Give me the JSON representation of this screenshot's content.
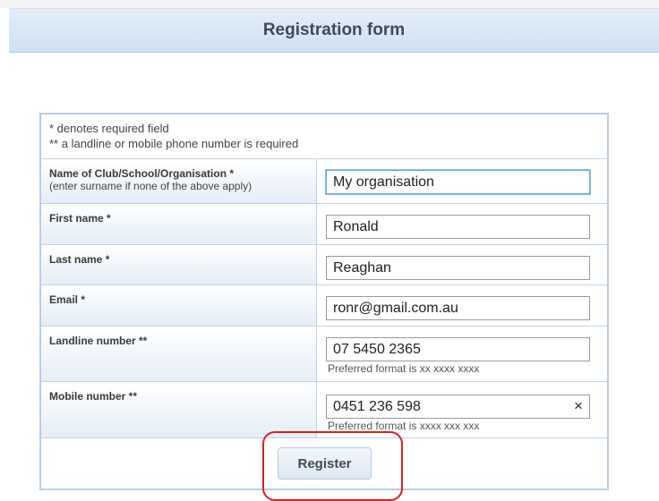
{
  "header": {
    "title": "Registration form"
  },
  "notes": {
    "required": "* denotes required field",
    "phone": "** a landline or mobile phone number is required"
  },
  "fields": {
    "organisation": {
      "label": "Name of Club/School/Organisation *",
      "sublabel": "(enter surname if none of the above apply)",
      "value": "My organisation"
    },
    "first_name": {
      "label": "First name *",
      "value": "Ronald"
    },
    "last_name": {
      "label": "Last name *",
      "value": "Reaghan"
    },
    "email": {
      "label": "Email *",
      "value": "ronr@gmail.com.au"
    },
    "landline": {
      "label": "Landline number **",
      "value": "07 5450 2365",
      "hint": "Preferred format is xx xxxx xxxx"
    },
    "mobile": {
      "label": "Mobile number **",
      "value": "0451 236 598",
      "hint": "Preferred format is xxxx xxx xxx",
      "clear_glyph": "×"
    }
  },
  "actions": {
    "register_label": "Register"
  },
  "colors": {
    "header_gradient_top": "#e3eef9",
    "header_gradient_bottom": "#cfe1f3",
    "border": "#b9cde2",
    "focus": "#6fa8dc",
    "annotation_ring": "#d92020"
  }
}
